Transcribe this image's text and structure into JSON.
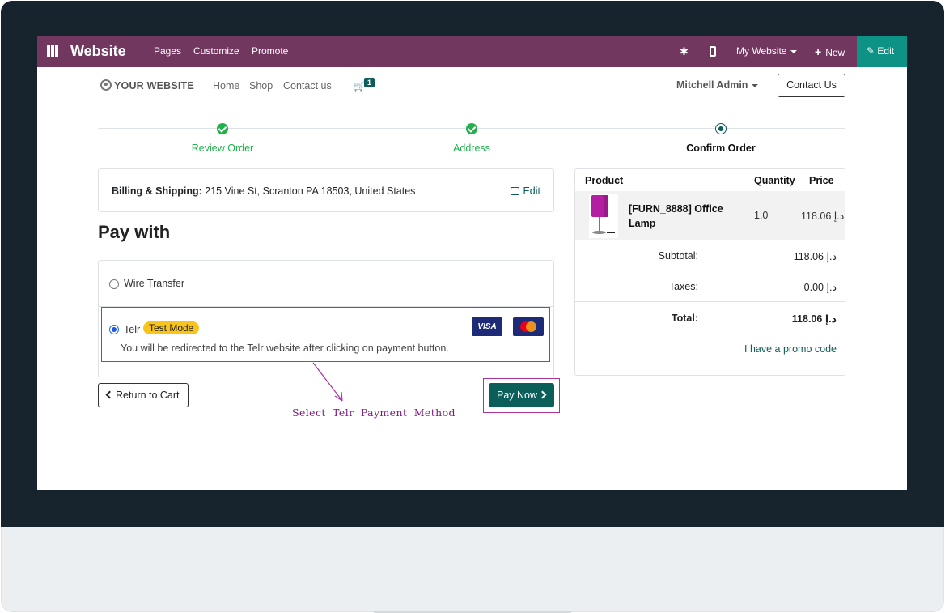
{
  "admin_bar": {
    "app_name": "Website",
    "menu": [
      "Pages",
      "Customize",
      "Promote"
    ],
    "website_selector": "My Website",
    "new_label": "New",
    "edit_label": "Edit",
    "color": "#71375f",
    "edit_color": "#0c9385"
  },
  "site_header": {
    "logo": "YOUR WEBSITE",
    "nav": [
      "Home",
      "Shop",
      "Contact us"
    ],
    "cart_count": "1",
    "user": "Mitchell Admin",
    "contact_button": "Contact Us"
  },
  "checkout_steps": [
    {
      "label": "Review Order",
      "state": "done"
    },
    {
      "label": "Address",
      "state": "done"
    },
    {
      "label": "Confirm Order",
      "state": "current"
    }
  ],
  "billing": {
    "label": "Billing & Shipping:",
    "address": "215 Vine St, Scranton PA 18503, United States",
    "edit_label": "Edit"
  },
  "payment": {
    "title": "Pay with",
    "methods": [
      {
        "name": "Wire Transfer",
        "selected": false
      },
      {
        "name": "Telr",
        "badge": "Test Mode",
        "selected": true,
        "note": "You will be redirected to the Telr website after clicking on payment button.",
        "cards": [
          "VISA",
          "mastercard-icon"
        ]
      }
    ],
    "return_button": "Return to Cart",
    "pay_button": "Pay Now"
  },
  "annotation": {
    "text": "Select Telr Payment Method",
    "color": "#a533a5"
  },
  "order_summary": {
    "headers": [
      "Product",
      "Quantity",
      "Price"
    ],
    "items": [
      {
        "name": "[FURN_8888] Office Lamp",
        "quantity": "1.0",
        "price": "118.06 د.إ"
      }
    ],
    "subtotal_label": "Subtotal:",
    "subtotal": "118.06 د.إ",
    "taxes_label": "Taxes:",
    "taxes": "0.00 د.إ",
    "total_label": "Total:",
    "total": "118.06 د.إ",
    "promo_link": "I have a promo code"
  }
}
